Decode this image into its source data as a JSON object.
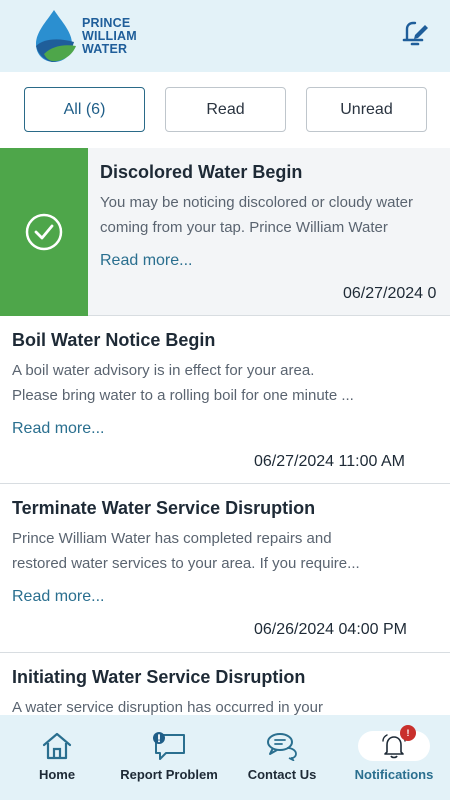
{
  "header": {
    "brand_line1": "PRINCE",
    "brand_line2": "WILLIAM",
    "brand_line3": "WATER",
    "edit_icon": "edit-pen-icon"
  },
  "filters": {
    "all": "All (6)",
    "read": "Read",
    "unread": "Unread",
    "selected": "All (6)"
  },
  "notifications": [
    {
      "title": "Discolored Water Begin",
      "body_line1": "You may be noticing discolored or cloudy water",
      "body_line2": "coming from your tap. Prince William Water",
      "read_more": "Read more...",
      "time": "06/27/2024 0",
      "status": "read"
    },
    {
      "title": "Boil Water Notice Begin",
      "body_line1": "A boil water advisory is in effect for your area.",
      "body_line2": "Please bring water to a rolling boil for one minute ...",
      "read_more": "Read more...",
      "time": "06/27/2024 11:00 AM"
    },
    {
      "title": "Terminate Water Service Disruption",
      "body_line1": "Prince William Water has completed repairs and",
      "body_line2": "restored water services to your area. If you require...",
      "read_more": "Read more...",
      "time": "06/26/2024 04:00 PM"
    },
    {
      "title": "Initiating Water Service Disruption",
      "body_line1": "A water service disruption has occurred in your"
    }
  ],
  "nav": {
    "home": "Home",
    "report": "Report Problem",
    "contact": "Contact Us",
    "notifications": "Notifications",
    "badge": "!"
  },
  "colors": {
    "header_bg": "#e3f2f8",
    "accent": "#2a6f8f",
    "swipe_green": "#4ea64a",
    "badge_red": "#c9302c"
  }
}
